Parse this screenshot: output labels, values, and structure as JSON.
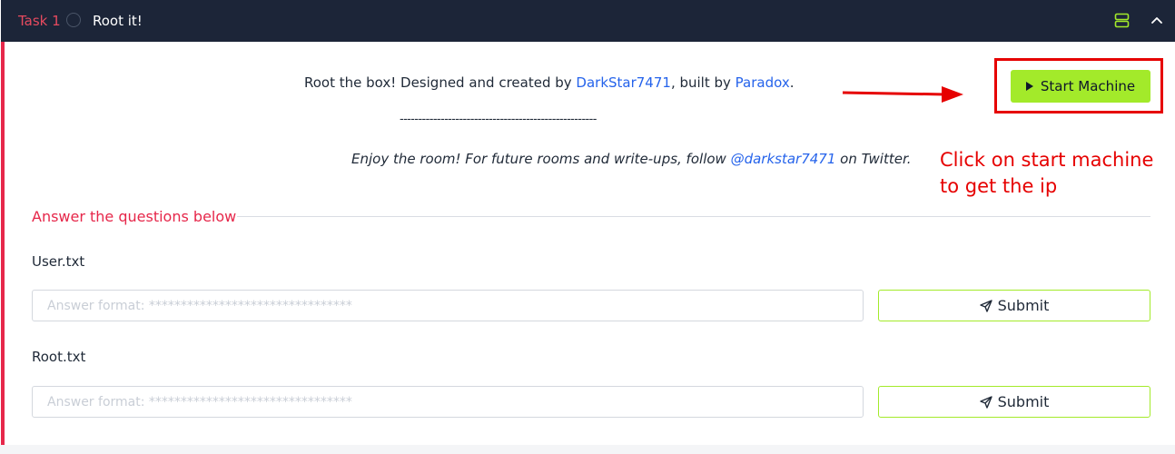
{
  "task": {
    "number_label": "Task 1",
    "title": "Root it!"
  },
  "description": {
    "line1_prefix": "Root the box! Designed and created by ",
    "author_link": "DarkStar7471",
    "line1_mid": ", built by ",
    "builder_link": "Paradox",
    "line1_suffix": ".",
    "separator": "-----------------------------------------------------",
    "line3_prefix": "Enjoy the room! For future rooms and write-ups, follow ",
    "twitter_link": "@darkstar7471",
    "line3_suffix": " on Twitter."
  },
  "start_machine": {
    "label": "Start Machine"
  },
  "annotation": {
    "text": "Click on start machine to get the ip",
    "color": "#e60000"
  },
  "answers": {
    "heading": "Answer the questions below",
    "questions": [
      {
        "label": "User.txt",
        "placeholder": "Answer format: ********************************",
        "submit_label": "Submit"
      },
      {
        "label": "Root.txt",
        "placeholder": "Answer format: ********************************",
        "submit_label": "Submit"
      }
    ]
  },
  "colors": {
    "header_bg": "#1c2538",
    "accent_red": "#e6274a",
    "accent_green": "#a3ea2a",
    "link_blue": "#2563eb"
  }
}
